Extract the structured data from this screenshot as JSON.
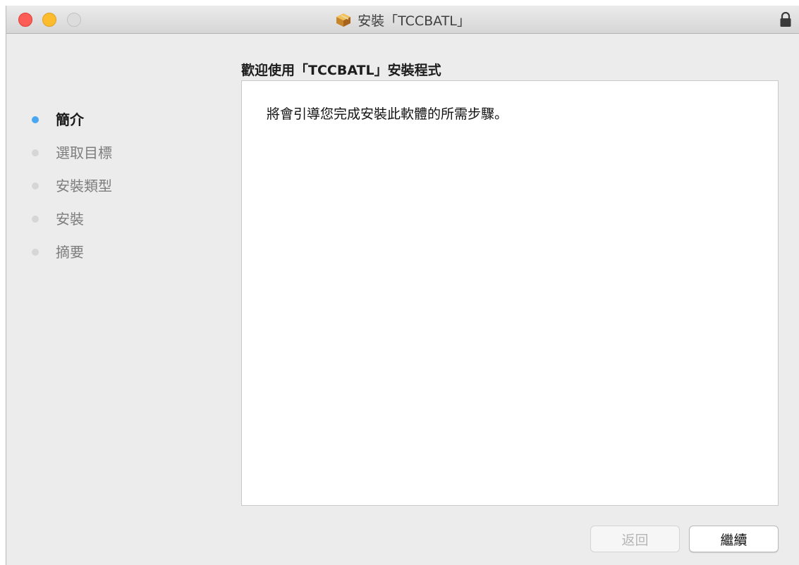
{
  "window": {
    "title": "安裝「TCCBATL」"
  },
  "header": {
    "heading": "歡迎使用「TCCBATL」安裝程式"
  },
  "sidebar": {
    "steps": [
      {
        "label": "簡介",
        "active": true
      },
      {
        "label": "選取目標",
        "active": false
      },
      {
        "label": "安裝類型",
        "active": false
      },
      {
        "label": "安裝",
        "active": false
      },
      {
        "label": "摘要",
        "active": false
      }
    ]
  },
  "main": {
    "body_text": "將會引導您完成安裝此軟體的所需步驟。"
  },
  "footer": {
    "back_label": "返回",
    "continue_label": "繼續"
  },
  "colors": {
    "active_step": "#48a6f3",
    "inactive_step": "#d6d6d6",
    "close": "#fc5d57",
    "minimize": "#fdbc2e"
  },
  "icons": {
    "title_icon": "package-icon",
    "lock_icon": "lock-icon"
  }
}
